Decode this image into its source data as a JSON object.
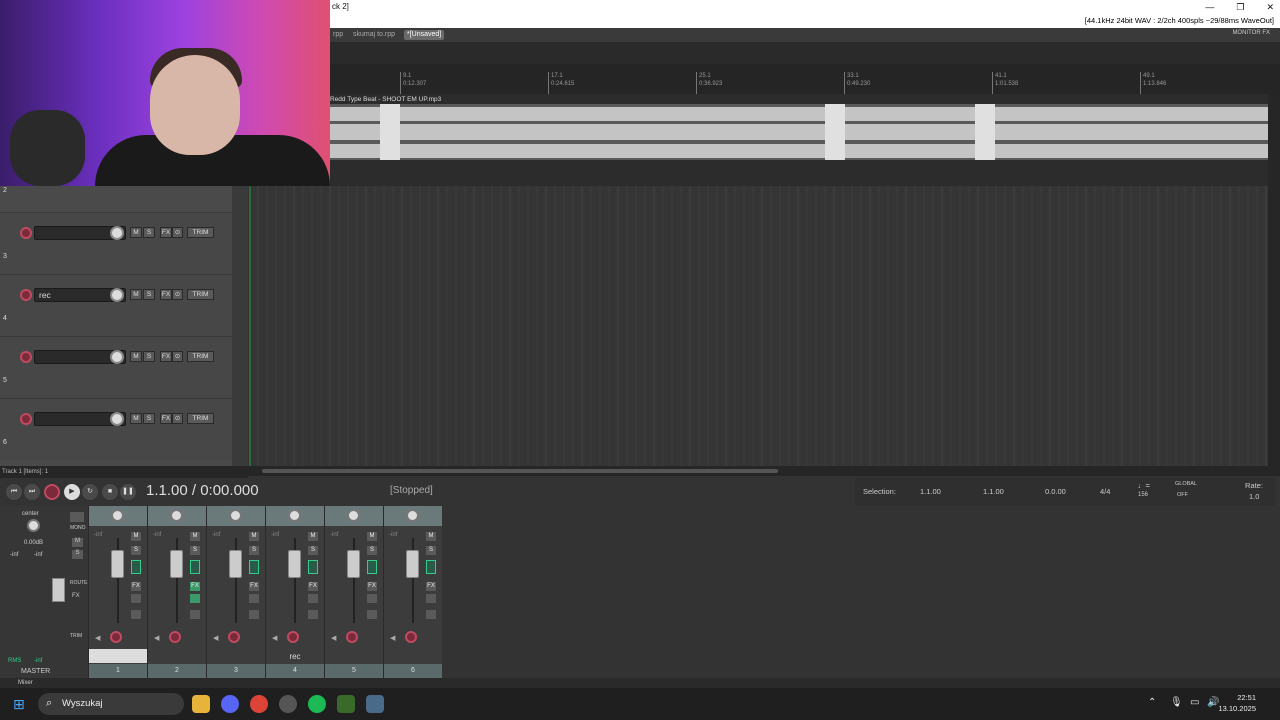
{
  "window": {
    "title_fragment": "ck 2]",
    "minimize": "—",
    "maximize": "❐",
    "close": "✕",
    "status": "[44.1kHz 24bit WAV : 2/2ch 400spls ~29/88ms WaveOut]"
  },
  "tabs": [
    {
      "label": "rpp"
    },
    {
      "label": "skumaj to.rpp"
    },
    {
      "label": "*[Unsaved]"
    }
  ],
  "monitor_fx": "MONITOR FX",
  "ruler": [
    {
      "bar": "9.1",
      "time": "0:12.307"
    },
    {
      "bar": "17.1",
      "time": "0:24.615"
    },
    {
      "bar": "25.1",
      "time": "0:36.923"
    },
    {
      "bar": "33.1",
      "time": "0:49.230"
    },
    {
      "bar": "41.1",
      "time": "1:01.538"
    },
    {
      "bar": "49.1",
      "time": "1:13.846"
    }
  ],
  "item_label": "Redd Type Beat - SHOOT EM UP.mp3",
  "tracks": [
    {
      "num": "2",
      "name": ""
    },
    {
      "num": "3",
      "name": "rec"
    },
    {
      "num": "4",
      "name": ""
    },
    {
      "num": "5",
      "name": ""
    },
    {
      "num": "6",
      "name": ""
    }
  ],
  "track_buttons": {
    "mute": "M",
    "solo": "S",
    "fx": "FX",
    "io": "⊙",
    "trim": "TRIM"
  },
  "status_line": "Track 1 [Items]: 1",
  "transport": {
    "position": "1.1.00 / 0:00.000",
    "state": "[Stopped]",
    "selection_label": "Selection:",
    "sel_start": "1.1.00",
    "sel_end": "1.1.00",
    "sel_len": "0.0.00",
    "time_sig": "4/4",
    "bpm": "156",
    "global": "GLOBAL",
    "off": "OFF",
    "rate_label": "Rate:",
    "rate": "1.0"
  },
  "master": {
    "pan": "center",
    "db": "0.00dB",
    "inf_l": "-inf",
    "inf_r": "-inf",
    "rms": "RMS",
    "rms_val": "-inf",
    "label": "MASTER",
    "mono": "MONO",
    "route": "ROUTE",
    "fx": "FX",
    "trim": "TRIM"
  },
  "mixer_strips": [
    {
      "num": "1",
      "label": "",
      "fx_on": false
    },
    {
      "num": "2",
      "label": "",
      "fx_on": true
    },
    {
      "num": "3",
      "label": "",
      "fx_on": false
    },
    {
      "num": "4",
      "label": "rec",
      "fx_on": false
    },
    {
      "num": "5",
      "label": "",
      "fx_on": false
    },
    {
      "num": "6",
      "label": "",
      "fx_on": false
    }
  ],
  "mixer_dock_label": "Mixer",
  "taskbar": {
    "search": "Wyszukaj",
    "time": "22:51",
    "date": "13.10.2025"
  },
  "colors": {
    "rec": "#c04a60",
    "accent_green": "#3c8",
    "fx_active": "#3c9a6a"
  }
}
